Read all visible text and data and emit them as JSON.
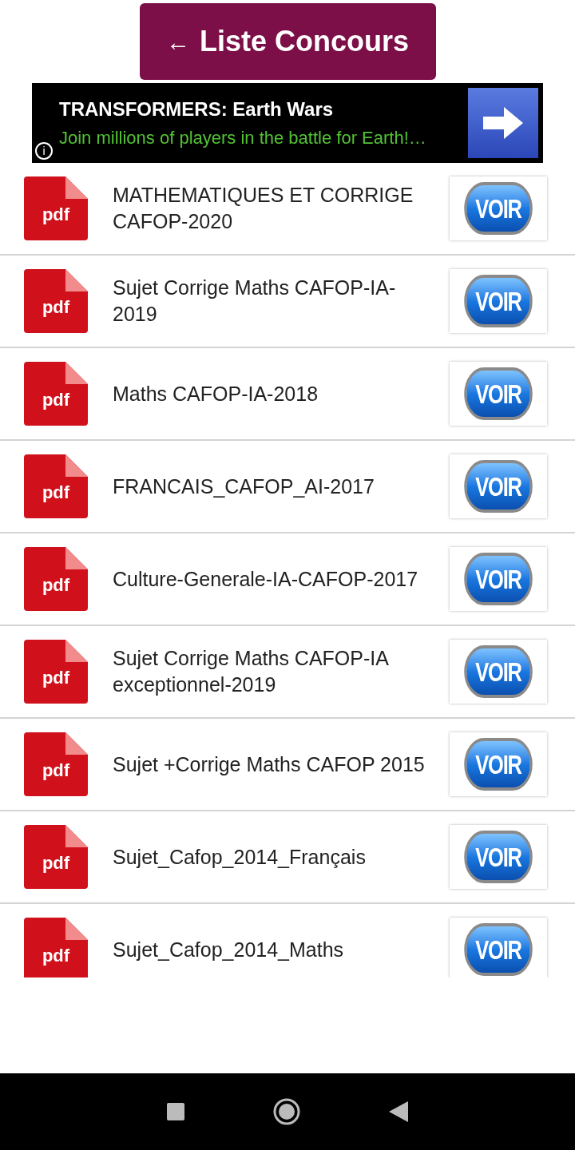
{
  "header_button": {
    "arrow": "←",
    "label": "Liste Concours"
  },
  "ad": {
    "title": "TRANSFORMERS: Earth Wars",
    "text": "Join millions of players in the battle for Earth!…",
    "info": "i"
  },
  "items": [
    {
      "icon_label": "pdf",
      "title": "MATHEMATIQUES ET CORRIGE CAFOP-2020",
      "button": "VOIR"
    },
    {
      "icon_label": "pdf",
      "title": "Sujet Corrige Maths CAFOP-IA-2019",
      "button": "VOIR"
    },
    {
      "icon_label": "pdf",
      "title": "Maths CAFOP-IA-2018",
      "button": "VOIR"
    },
    {
      "icon_label": "pdf",
      "title": "FRANCAIS_CAFOP_AI-2017",
      "button": "VOIR"
    },
    {
      "icon_label": "pdf",
      "title": "Culture-Generale-IA-CAFOP-2017",
      "button": "VOIR"
    },
    {
      "icon_label": "pdf",
      "title": "Sujet Corrige Maths CAFOP-IA exceptionnel-2019",
      "button": "VOIR"
    },
    {
      "icon_label": "pdf",
      "title": "Sujet +Corrige Maths CAFOP 2015",
      "button": "VOIR"
    },
    {
      "icon_label": "pdf",
      "title": "Sujet_Cafop_2014_Français",
      "button": "VOIR"
    },
    {
      "icon_label": "pdf",
      "title": "Sujet_Cafop_2014_Maths",
      "button": "VOIR"
    }
  ]
}
